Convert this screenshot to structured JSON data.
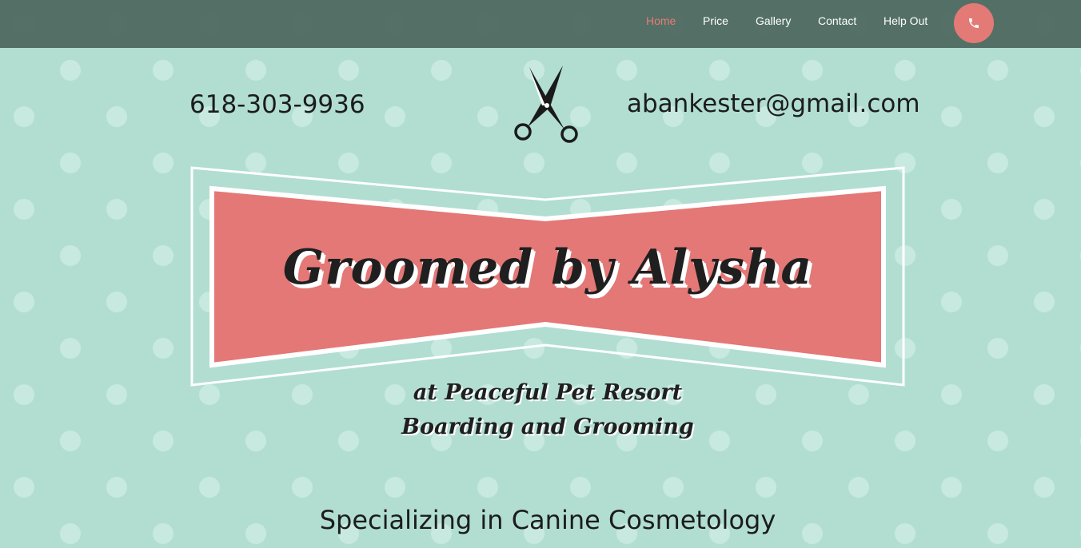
{
  "nav": {
    "items": [
      {
        "label": "Home",
        "active": true
      },
      {
        "label": "Price"
      },
      {
        "label": "Gallery"
      },
      {
        "label": "Contact"
      },
      {
        "label": "Help Out"
      }
    ],
    "call_icon": "phone-icon"
  },
  "header": {
    "phone": "618-303-9936",
    "email": "abankester@gmail.com",
    "logo_icon": "scissors-icon"
  },
  "banner": {
    "title": "Groomed by Alysha",
    "tagline_line1": "at Peaceful Pet Resort",
    "tagline_line2": "Boarding and Grooming"
  },
  "specialty": "Specializing in Canine Cosmetology",
  "colors": {
    "background": "#b1ded1",
    "dots": "#c8e9df",
    "navbar": "#566b62",
    "accent": "#e47a76",
    "text": "#1c1c1c"
  }
}
